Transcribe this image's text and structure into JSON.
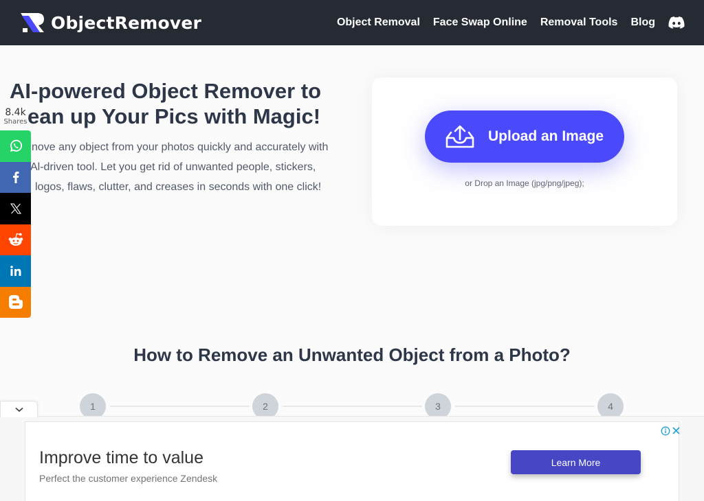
{
  "header": {
    "logo_text": "ObjectRemover",
    "nav": [
      {
        "label": "Object Removal"
      },
      {
        "label": "Face Swap Online"
      },
      {
        "label": "Removal Tools"
      },
      {
        "label": "Blog"
      }
    ],
    "discord_icon": "discord-icon"
  },
  "hero": {
    "title_line1": "AI-powered Object Remover to",
    "title_line2": "ean up Your Pics with Magic!",
    "description_lines": [
      "nove any object from your photos quickly and accurately with",
      "Al-driven tool. Let you get rid of unwanted people, stickers,",
      "logos, flaws, clutter, and creases in seconds with one click!"
    ]
  },
  "upload": {
    "button_label": "Upload an Image",
    "drop_text": "or Drop an Image (jpg/png/jpeg);",
    "accent_color": "#4a4afc"
  },
  "share": {
    "count": "8.4k",
    "count_label": "Shares",
    "buttons": [
      {
        "network": "whatsapp",
        "icon": "whatsapp-icon",
        "color": "#25d366"
      },
      {
        "network": "facebook",
        "icon": "facebook-icon",
        "color": "#4267b2"
      },
      {
        "network": "x",
        "icon": "x-icon",
        "color": "#000000"
      },
      {
        "network": "reddit",
        "icon": "reddit-icon",
        "color": "#ff4500"
      },
      {
        "network": "linkedin",
        "icon": "linkedin-icon",
        "color": "#0077b5"
      },
      {
        "network": "blogger",
        "icon": "blogger-icon",
        "color": "#f57d00"
      }
    ]
  },
  "howto": {
    "title": "How to Remove an Unwanted Object from a Photo?",
    "steps": [
      "1",
      "2",
      "3",
      "4"
    ]
  },
  "ad": {
    "title": "Improve time to value",
    "subtitle": "Perfect the customer experience Zendesk",
    "button_label": "Learn More",
    "button_color": "#4746c4"
  }
}
